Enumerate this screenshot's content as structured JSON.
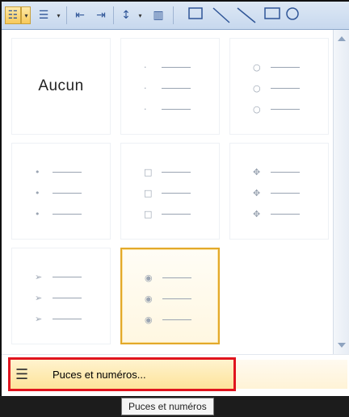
{
  "toolbar": {
    "buttons": [
      {
        "name": "bullets-icon",
        "glyph": "☷",
        "active": true
      },
      {
        "name": "bullets-dropdown-icon",
        "glyph": "▾",
        "active": true
      },
      {
        "name": "numbering-icon",
        "glyph": "☰"
      },
      {
        "name": "numbering-dropdown-icon",
        "glyph": "▾"
      },
      {
        "name": "decrease-indent-icon",
        "glyph": "⇤"
      },
      {
        "name": "increase-indent-icon",
        "glyph": "⇥"
      },
      {
        "name": "line-spacing-icon",
        "glyph": "↕"
      },
      {
        "name": "text-columns-icon",
        "glyph": "▥"
      }
    ]
  },
  "gallery": {
    "none_label": "Aucun",
    "styles": [
      {
        "name": "none",
        "bullet": ""
      },
      {
        "name": "small-dot",
        "bullet": "·"
      },
      {
        "name": "hollow-circle",
        "bullet": "○"
      },
      {
        "name": "filled-dot",
        "bullet": "•"
      },
      {
        "name": "hollow-square",
        "bullet": "□"
      },
      {
        "name": "four-diamonds",
        "bullet": "✥"
      },
      {
        "name": "arrow",
        "bullet": "➢"
      },
      {
        "name": "checkmark",
        "bullet": "◉"
      }
    ],
    "selected_index": 7
  },
  "menu": {
    "item_label": "Puces et numéros...",
    "item_icon": "list-icon"
  },
  "tooltip": {
    "text": "Puces et numéros"
  },
  "colors": {
    "highlight_border": "#e0141e",
    "selected_border": "#e3a92a"
  }
}
